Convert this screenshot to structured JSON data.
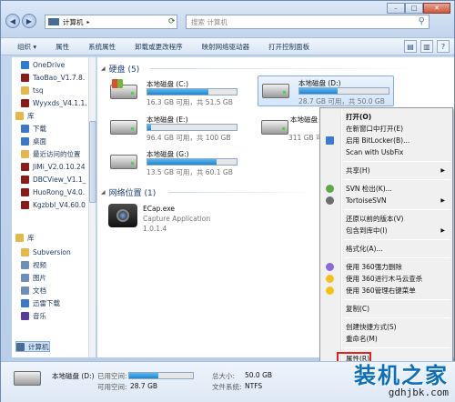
{
  "window": {
    "address": "计算机",
    "search_placeholder": "搜索 计算机"
  },
  "toolbar": {
    "items": [
      "组织 ▾",
      "属性",
      "系统属性",
      "卸载或更改程序",
      "映射网络驱动器",
      "打开控制面板"
    ]
  },
  "sidebar": {
    "items": [
      {
        "label": "OneDrive",
        "color": "#2b7cd3"
      },
      {
        "label": "TaoBao_V1.7.8.",
        "color": "#8b1a1a"
      },
      {
        "label": "tsq",
        "color": "#e6b84a"
      },
      {
        "label": "Wyyxds_V4.1.1.",
        "color": "#8b1a1a"
      },
      {
        "label": "库",
        "color": "#e6b84a"
      },
      {
        "label": "下载",
        "color": "#3a78c9"
      },
      {
        "label": "桌面",
        "color": "#3a78c9"
      },
      {
        "label": "最近访问的位置",
        "color": "#e6b84a"
      },
      {
        "label": "JiMi_V2.0.10.24",
        "color": "#8b1a1a"
      },
      {
        "label": "DBCView_V1.1_",
        "color": "#8b1a1a"
      },
      {
        "label": "HuoRong_V4.0.",
        "color": "#8b1a1a"
      },
      {
        "label": "Kgzbbl_V4.60.0",
        "color": "#8b1a1a"
      },
      {
        "label": "库",
        "color": "#e6b84a"
      },
      {
        "label": "Subversion",
        "color": "#e6b84a"
      },
      {
        "label": "视频",
        "color": "#6f8fb9"
      },
      {
        "label": "图片",
        "color": "#6f8fb9"
      },
      {
        "label": "文档",
        "color": "#6f8fb9"
      },
      {
        "label": "迅雷下载",
        "color": "#3a78c9"
      },
      {
        "label": "音乐",
        "color": "#5c3a9c"
      },
      {
        "label": "计算机",
        "color": "#4a6a98"
      }
    ]
  },
  "content": {
    "hdd_group": "硬盘 (5)",
    "net_group": "网络位置 (1)",
    "drives": [
      {
        "name": "本地磁盘 (C:)",
        "free": "16.3 GB 可用，共 51.5 GB",
        "used_fraction": 0.68
      },
      {
        "name": "本地磁盘 (D:)",
        "free": "28.7 GB 可用，共 50.0 GB",
        "used_fraction": 0.43
      },
      {
        "name": "本地磁盘 (E:)",
        "free": "96.4 GB 可用，共 100 GB",
        "used_fraction": 0.04
      },
      {
        "name": "本地磁盘 (F:)",
        "free": "311 GB 可",
        "used_fraction": 0.3
      },
      {
        "name": "本地磁盘 (G:)",
        "free": "13.5 GB 可用，共 60.1 GB",
        "used_fraction": 0.78
      }
    ],
    "network": {
      "name": "ECap.exe",
      "desc": "Capture Application",
      "version": "1.0.1.4"
    }
  },
  "menu": {
    "items": [
      "打开(O)",
      "在新窗口中打开(E)",
      "启用 BitLocker(B)...",
      "Scan with UsbFix",
      "共享(H)",
      "SVN 检出(K)...",
      "TortoiseSVN",
      "还原以前的版本(V)",
      "包含到库中(I)",
      "格式化(A)...",
      "使用 360强力删除",
      "使用 360进行木马云查杀",
      "使用 360管理右键菜单",
      "复制(C)",
      "创建快捷方式(S)",
      "重命名(M)",
      "属性(R)"
    ]
  },
  "details": {
    "drive_name": "本地磁盘 (D:)",
    "used_label": "已用空间:",
    "free_label": "可用空间:",
    "free_value": "28.7 GB",
    "total_label": "总大小:",
    "total_value": "50.0 GB",
    "fs_label": "文件系统:",
    "fs_value": "NTFS",
    "used_fraction": 0.43
  },
  "watermark": {
    "title": "装机之家",
    "url": "gdhjbk.com"
  }
}
